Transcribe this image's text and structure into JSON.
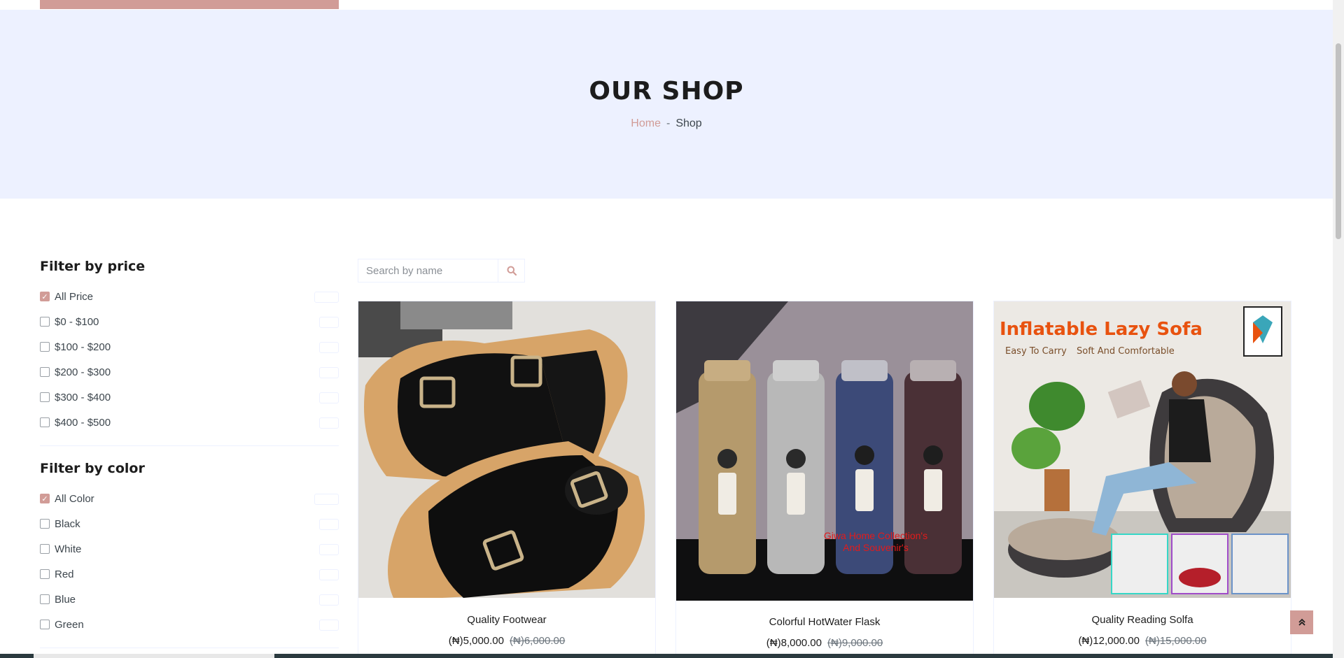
{
  "hero": {
    "title": "OUR SHOP",
    "breadcrumb": {
      "home": "Home",
      "separator": "-",
      "current": "Shop"
    }
  },
  "filters": {
    "price": {
      "title": "Filter by price",
      "items": [
        {
          "label": "All Price",
          "checked": true
        },
        {
          "label": "$0 - $100",
          "checked": false
        },
        {
          "label": "$100 - $200",
          "checked": false
        },
        {
          "label": "$200 - $300",
          "checked": false
        },
        {
          "label": "$300 - $400",
          "checked": false
        },
        {
          "label": "$400 - $500",
          "checked": false
        }
      ]
    },
    "color": {
      "title": "Filter by color",
      "items": [
        {
          "label": "All Color",
          "checked": true
        },
        {
          "label": "Black",
          "checked": false
        },
        {
          "label": "White",
          "checked": false
        },
        {
          "label": "Red",
          "checked": false
        },
        {
          "label": "Blue",
          "checked": false
        },
        {
          "label": "Green",
          "checked": false
        }
      ]
    }
  },
  "search": {
    "placeholder": "Search by name",
    "value": "",
    "icon": "search-icon"
  },
  "products": [
    {
      "name": "Quality Footwear",
      "price": "(₦)5,000.00",
      "old_price": "(₦)6,000.00"
    },
    {
      "name": "Colorful HotWater Flask",
      "price": "(₦)8,000.00",
      "old_price": "(₦)9,000.00",
      "image_text": [
        "Giwa Home Collection's",
        "And Souvenir's"
      ]
    },
    {
      "name": "Quality Reading Solfa",
      "price": "(₦)12,000.00",
      "old_price": "(₦)15,000.00",
      "image_text": [
        "Inflatable Lazy Sofa",
        "Easy To Carry",
        "Soft And Comfortable"
      ]
    }
  ],
  "back_to_top": {
    "icon": "double-chevron-up-icon"
  },
  "colors": {
    "accent": "#d19c97",
    "hero_bg": "#edf1ff",
    "text_dark": "#1c1c1c"
  }
}
